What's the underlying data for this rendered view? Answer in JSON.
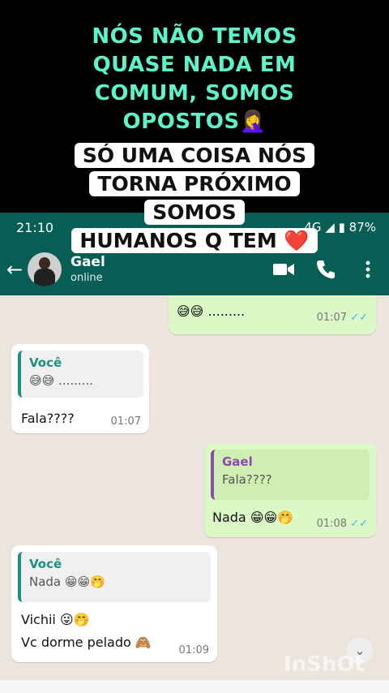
{
  "caption": {
    "line1": [
      "NÓS NÃO TEMOS",
      "QUASE NADA EM",
      "COMUM, SOMOS",
      "OPOSTOS🤦‍♀️"
    ],
    "line2": [
      "SÓ UMA COISA  NÓS",
      "TORNA PRÓXIMO",
      "SOMOS",
      "HUMANOS Q TEM ❤️"
    ]
  },
  "status_bar": {
    "time": "21:10",
    "signal": "4G",
    "battery": "87%"
  },
  "header": {
    "contact_name": "Gael",
    "contact_status": "online"
  },
  "messages": [
    {
      "text": "😅😅 .........",
      "time": "01:07"
    },
    {
      "quote_name": "Você",
      "quote_text": "😅😅 .........",
      "text": "Fala????",
      "time": "01:07"
    },
    {
      "quote_name": "Gael",
      "quote_text": "Fala????",
      "text": "Nada 😁😁🤭",
      "time": "01:08"
    },
    {
      "quote_name": "Você",
      "quote_text": "Nada 😁😁🤭",
      "text1": "Vichii 😜🤭",
      "text2": "Vc dorme pelado 🙈",
      "time": "01:09"
    }
  ],
  "watermark": "InShOt"
}
